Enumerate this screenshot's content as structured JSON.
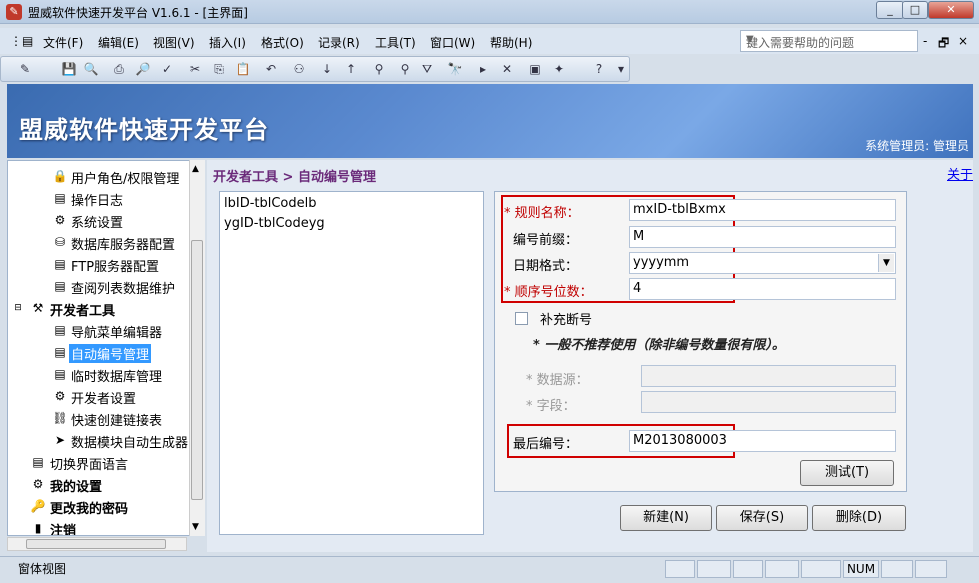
{
  "window": {
    "title": "盟威软件快速开发平台 V1.6.1 - [主界面]",
    "min_label": "_",
    "max_label": "□",
    "close_label": "✕",
    "mdi_min": "-",
    "mdi_restore": "🗗",
    "mdi_close": "×"
  },
  "menu": {
    "items": [
      "文件(F)",
      "编辑(E)",
      "视图(V)",
      "插入(I)",
      "格式(O)",
      "记录(R)",
      "工具(T)",
      "窗口(W)",
      "帮助(H)"
    ],
    "help_placeholder": "键入需要帮助的问题"
  },
  "banner": {
    "title": "盟威软件快速开发平台",
    "user": "系统管理员: 管理员"
  },
  "tree": {
    "items": [
      {
        "label": "用户角色/权限管理",
        "icon": "lock-icon"
      },
      {
        "label": "操作日志",
        "icon": "document-icon"
      },
      {
        "label": "系统设置",
        "icon": "settings-icon"
      },
      {
        "label": "数据库服务器配置",
        "icon": "database-icon"
      },
      {
        "label": "FTP服务器配置",
        "icon": "document-icon"
      },
      {
        "label": "查阅列表数据维护",
        "icon": "document-icon"
      },
      {
        "label": "开发者工具",
        "icon": "tools-icon"
      },
      {
        "label": "导航菜单编辑器",
        "icon": "document-icon"
      },
      {
        "label": "自动编号管理",
        "icon": "document-icon"
      },
      {
        "label": "临时数据库管理",
        "icon": "document-icon"
      },
      {
        "label": "开发者设置",
        "icon": "settings-icon"
      },
      {
        "label": "快速创建链接表",
        "icon": "link-icon"
      },
      {
        "label": "数据模块自动生成器",
        "icon": "generator-icon"
      },
      {
        "label": "切换界面语言",
        "icon": "document-icon"
      },
      {
        "label": "我的设置",
        "icon": "settings-icon"
      },
      {
        "label": "更改我的密码",
        "icon": "key-icon"
      },
      {
        "label": "注销",
        "icon": "logout-icon"
      }
    ]
  },
  "breadcrumb": "开发者工具 > 自动编号管理",
  "about_link": "关于",
  "rules_list": [
    "lbID-tblCodelb",
    "ygID-tblCodeyg"
  ],
  "form": {
    "rule_name_label": "* 规则名称：",
    "rule_name_value": "mxID-tblBxmx",
    "prefix_label": "编号前缀：",
    "prefix_value": "M",
    "date_format_label": "日期格式：",
    "date_format_value": "yyyymm",
    "seq_digits_label": "* 顺序号位数：",
    "seq_digits_value": "4",
    "fill_gap_label": "补充断号",
    "fill_gap_note": "* 一般不推荐使用（除非编号数量很有限）。",
    "datasource_label": "* 数据源：",
    "field_label": "* 字段：",
    "last_number_label": "最后编号：",
    "last_number_value": "M2013080003",
    "test_button": "测试(T)"
  },
  "actions": {
    "new": "新建(N)",
    "save": "保存(S)",
    "delete": "删除(D)"
  },
  "status": {
    "text": "窗体视图",
    "num": "NUM"
  }
}
